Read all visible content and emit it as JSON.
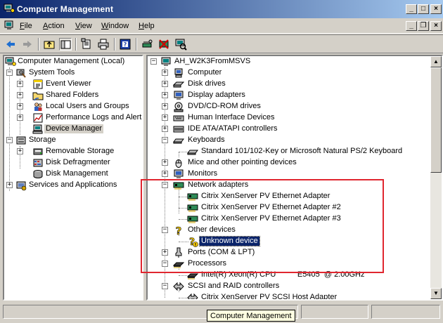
{
  "window": {
    "title": "Computer Management",
    "controls": {
      "minimize": "_",
      "maximize": "□",
      "close": "×"
    }
  },
  "menu": [
    {
      "label": "File",
      "accel": "F",
      "rest": "ile"
    },
    {
      "label": "Action",
      "accel": "A",
      "rest": "ction"
    },
    {
      "label": "View",
      "accel": "V",
      "rest": "iew"
    },
    {
      "label": "Window",
      "accel": "W",
      "rest": "indow"
    },
    {
      "label": "Help",
      "accel": "H",
      "rest": "elp"
    }
  ],
  "mdi_controls": {
    "minimize": "_",
    "restore": "❐",
    "close": "×"
  },
  "toolbar": [
    "back-icon",
    "forward-icon",
    "up-level-icon",
    "show-hide-tree-icon",
    "properties-icon",
    "print-icon",
    "help-icon",
    "update-driver-icon",
    "uninstall-icon",
    "scan-hardware-icon"
  ],
  "left_tree": {
    "root": "Computer Management (Local)",
    "system_tools": "System Tools",
    "event_viewer": "Event Viewer",
    "shared_folders": "Shared Folders",
    "local_users": "Local Users and Groups",
    "perf_logs": "Performance Logs and Alerts",
    "device_manager": "Device Manager",
    "storage": "Storage",
    "removable_storage": "Removable Storage",
    "disk_defrag": "Disk Defragmenter",
    "disk_mgmt": "Disk Management",
    "services_apps": "Services and Applications"
  },
  "right_tree": {
    "root": "AH_W2K3FromMSVS",
    "computer": "Computer",
    "disk_drives": "Disk drives",
    "display_adapters": "Display adapters",
    "dvd": "DVD/CD-ROM drives",
    "hid": "Human Interface Devices",
    "ide": "IDE ATA/ATAPI controllers",
    "keyboards": "Keyboards",
    "keyboard_std": "Standard 101/102-Key or Microsoft Natural PS/2 Keyboard",
    "mice": "Mice and other pointing devices",
    "monitors": "Monitors",
    "network": "Network adapters",
    "nic1": "Citrix XenServer PV Ethernet Adapter",
    "nic2": "Citrix XenServer PV Ethernet Adapter #2",
    "nic3": "Citrix XenServer PV Ethernet Adapter #3",
    "other": "Other devices",
    "unknown": "Unknown device",
    "ports": "Ports (COM & LPT)",
    "processors": "Processors",
    "cpu": "Intel(R) Xeon(R) CPU          E5405  @ 2.00GHz",
    "scsi": "SCSI and RAID controllers",
    "scsi_adapter": "Citrix XenServer PV SCSI Host Adapter"
  },
  "tooltip": "Computer Management",
  "colors": {
    "selection": "#0a246a",
    "highlight_box": "#e0262f",
    "title_start": "#0a246a",
    "title_end": "#a6caf0"
  }
}
